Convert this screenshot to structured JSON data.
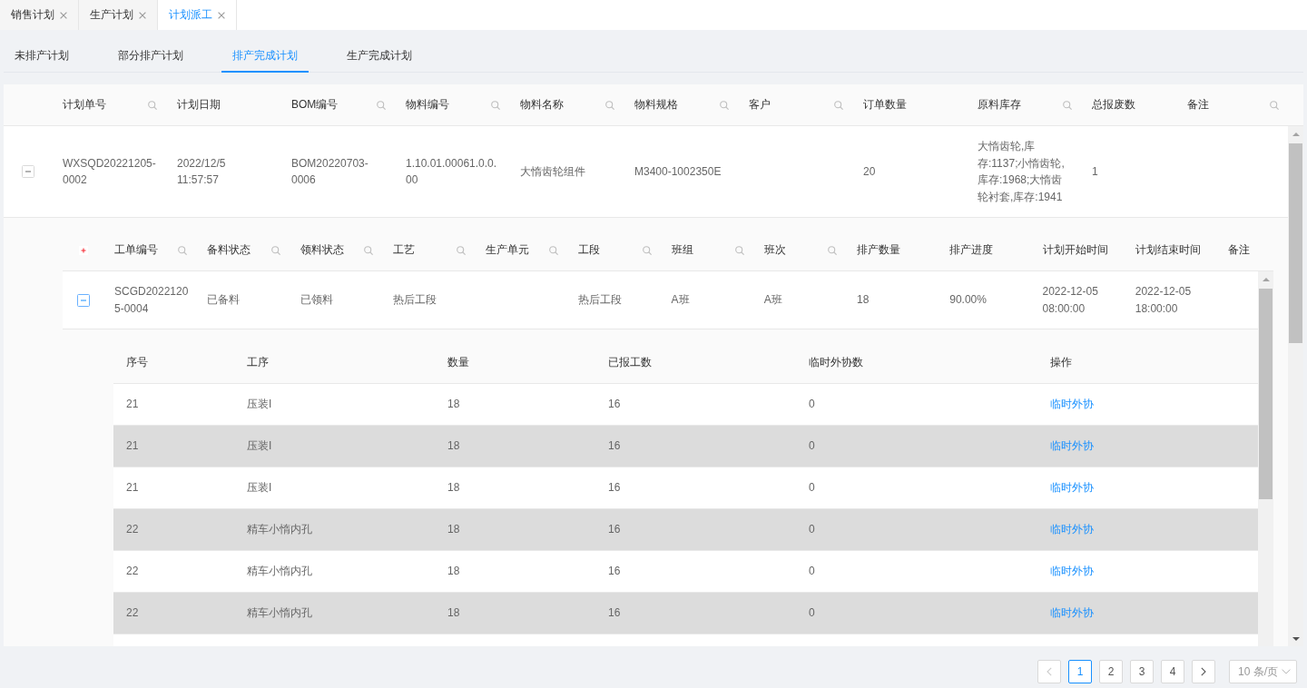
{
  "doc_tabs": [
    {
      "label": "销售计划",
      "selected": false
    },
    {
      "label": "生产计划",
      "selected": false
    },
    {
      "label": "计划派工",
      "selected": true
    }
  ],
  "plan_tabs": [
    {
      "label": "未排产计划",
      "selected": false
    },
    {
      "label": "部分排产计划",
      "selected": false
    },
    {
      "label": "排产完成计划",
      "selected": true
    },
    {
      "label": "生产完成计划",
      "selected": false
    }
  ],
  "plan_table": {
    "columns": [
      {
        "label": "计划单号",
        "searchable": true
      },
      {
        "label": "计划日期",
        "searchable": false
      },
      {
        "label": "BOM编号",
        "searchable": true
      },
      {
        "label": "物料编号",
        "searchable": true
      },
      {
        "label": "物料名称",
        "searchable": true
      },
      {
        "label": "物料规格",
        "searchable": true
      },
      {
        "label": "客户",
        "searchable": true
      },
      {
        "label": "订单数量",
        "searchable": false
      },
      {
        "label": "原料库存",
        "searchable": true
      },
      {
        "label": "总报废数",
        "searchable": false
      },
      {
        "label": "备注",
        "searchable": true
      }
    ],
    "rows": [
      {
        "cells": [
          "WXSQD20221205-0002",
          "2022/12/5 11:57:57",
          "BOM20220703-0006",
          "1.10.01.00061.0.0.00",
          "大惰齿轮组件",
          "M3400-1002350E",
          null,
          "20",
          "大惰齿轮,库存:1137;小惰齿轮,库存:1968;大惰齿轮衬套,库存:1941",
          "1",
          null
        ],
        "expanded": true,
        "work_orders": {
          "columns": [
            {
              "label": "工单编号",
              "searchable": true
            },
            {
              "label": "备料状态",
              "searchable": true
            },
            {
              "label": "领料状态",
              "searchable": true
            },
            {
              "label": "工艺",
              "searchable": true
            },
            {
              "label": "生产单元",
              "searchable": true
            },
            {
              "label": "工段",
              "searchable": true
            },
            {
              "label": "班组",
              "searchable": true
            },
            {
              "label": "班次",
              "searchable": true
            },
            {
              "label": "排产数量",
              "searchable": false
            },
            {
              "label": "排产进度",
              "searchable": false
            },
            {
              "label": "计划开始时间",
              "searchable": false
            },
            {
              "label": "计划结束时间",
              "searchable": false
            },
            {
              "label": "备注",
              "searchable": false
            }
          ],
          "rows": [
            {
              "cells": [
                "SCGD20221205-0004",
                "已备料",
                "已领料",
                "热后工段",
                null,
                "热后工段",
                "A班",
                "A班",
                "18",
                "90.00%",
                "2022-12-05 08:00:00",
                "2022-12-05 18:00:00",
                null
              ],
              "expanded": true,
              "processes": {
                "columns": [
                  {
                    "label": "序号",
                    "kind": "text"
                  },
                  {
                    "label": "工序",
                    "kind": "text"
                  },
                  {
                    "label": "数量",
                    "kind": "text"
                  },
                  {
                    "label": "已报工数",
                    "kind": "text"
                  },
                  {
                    "label": "临时外协数",
                    "kind": "text"
                  },
                  {
                    "label": "操作",
                    "kind": "link"
                  }
                ],
                "rows": [
                  {
                    "cells": [
                      "21",
                      "压装I",
                      "18",
                      "16",
                      "0",
                      "临时外协"
                    ]
                  },
                  {
                    "cells": [
                      "21",
                      "压装I",
                      "18",
                      "16",
                      "0",
                      "临时外协"
                    ]
                  },
                  {
                    "cells": [
                      "21",
                      "压装I",
                      "18",
                      "16",
                      "0",
                      "临时外协"
                    ]
                  },
                  {
                    "cells": [
                      "22",
                      "精车小惰内孔",
                      "18",
                      "16",
                      "0",
                      "临时外协"
                    ]
                  },
                  {
                    "cells": [
                      "22",
                      "精车小惰内孔",
                      "18",
                      "16",
                      "0",
                      "临时外协"
                    ]
                  },
                  {
                    "cells": [
                      "22",
                      "精车小惰内孔",
                      "18",
                      "16",
                      "0",
                      "临时外协"
                    ]
                  }
                ]
              }
            }
          ]
        }
      }
    ]
  },
  "pagination": {
    "previous": {
      "disabled": true
    },
    "pages": [
      {
        "label": "1",
        "selected": true
      },
      {
        "label": "2",
        "selected": false
      },
      {
        "label": "3",
        "selected": false
      },
      {
        "label": "4",
        "selected": false
      }
    ],
    "next": {
      "disabled": false
    },
    "page_size": "10 条/页"
  }
}
